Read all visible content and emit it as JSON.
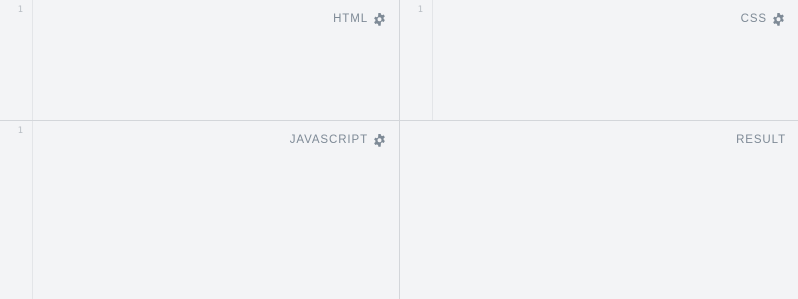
{
  "panels": {
    "html": {
      "label": "HTML",
      "line_number": "1",
      "icon": "gear-icon"
    },
    "css": {
      "label": "CSS",
      "line_number": "1",
      "icon": "gear-icon"
    },
    "javascript": {
      "label": "JAVASCRIPT",
      "line_number": "1",
      "icon": "gear-icon"
    },
    "result": {
      "label": "RESULT"
    }
  },
  "colors": {
    "background": "#f3f4f6",
    "label": "#7e8a96",
    "line_number": "#b8bdc3",
    "divider": "#d3d6da"
  }
}
